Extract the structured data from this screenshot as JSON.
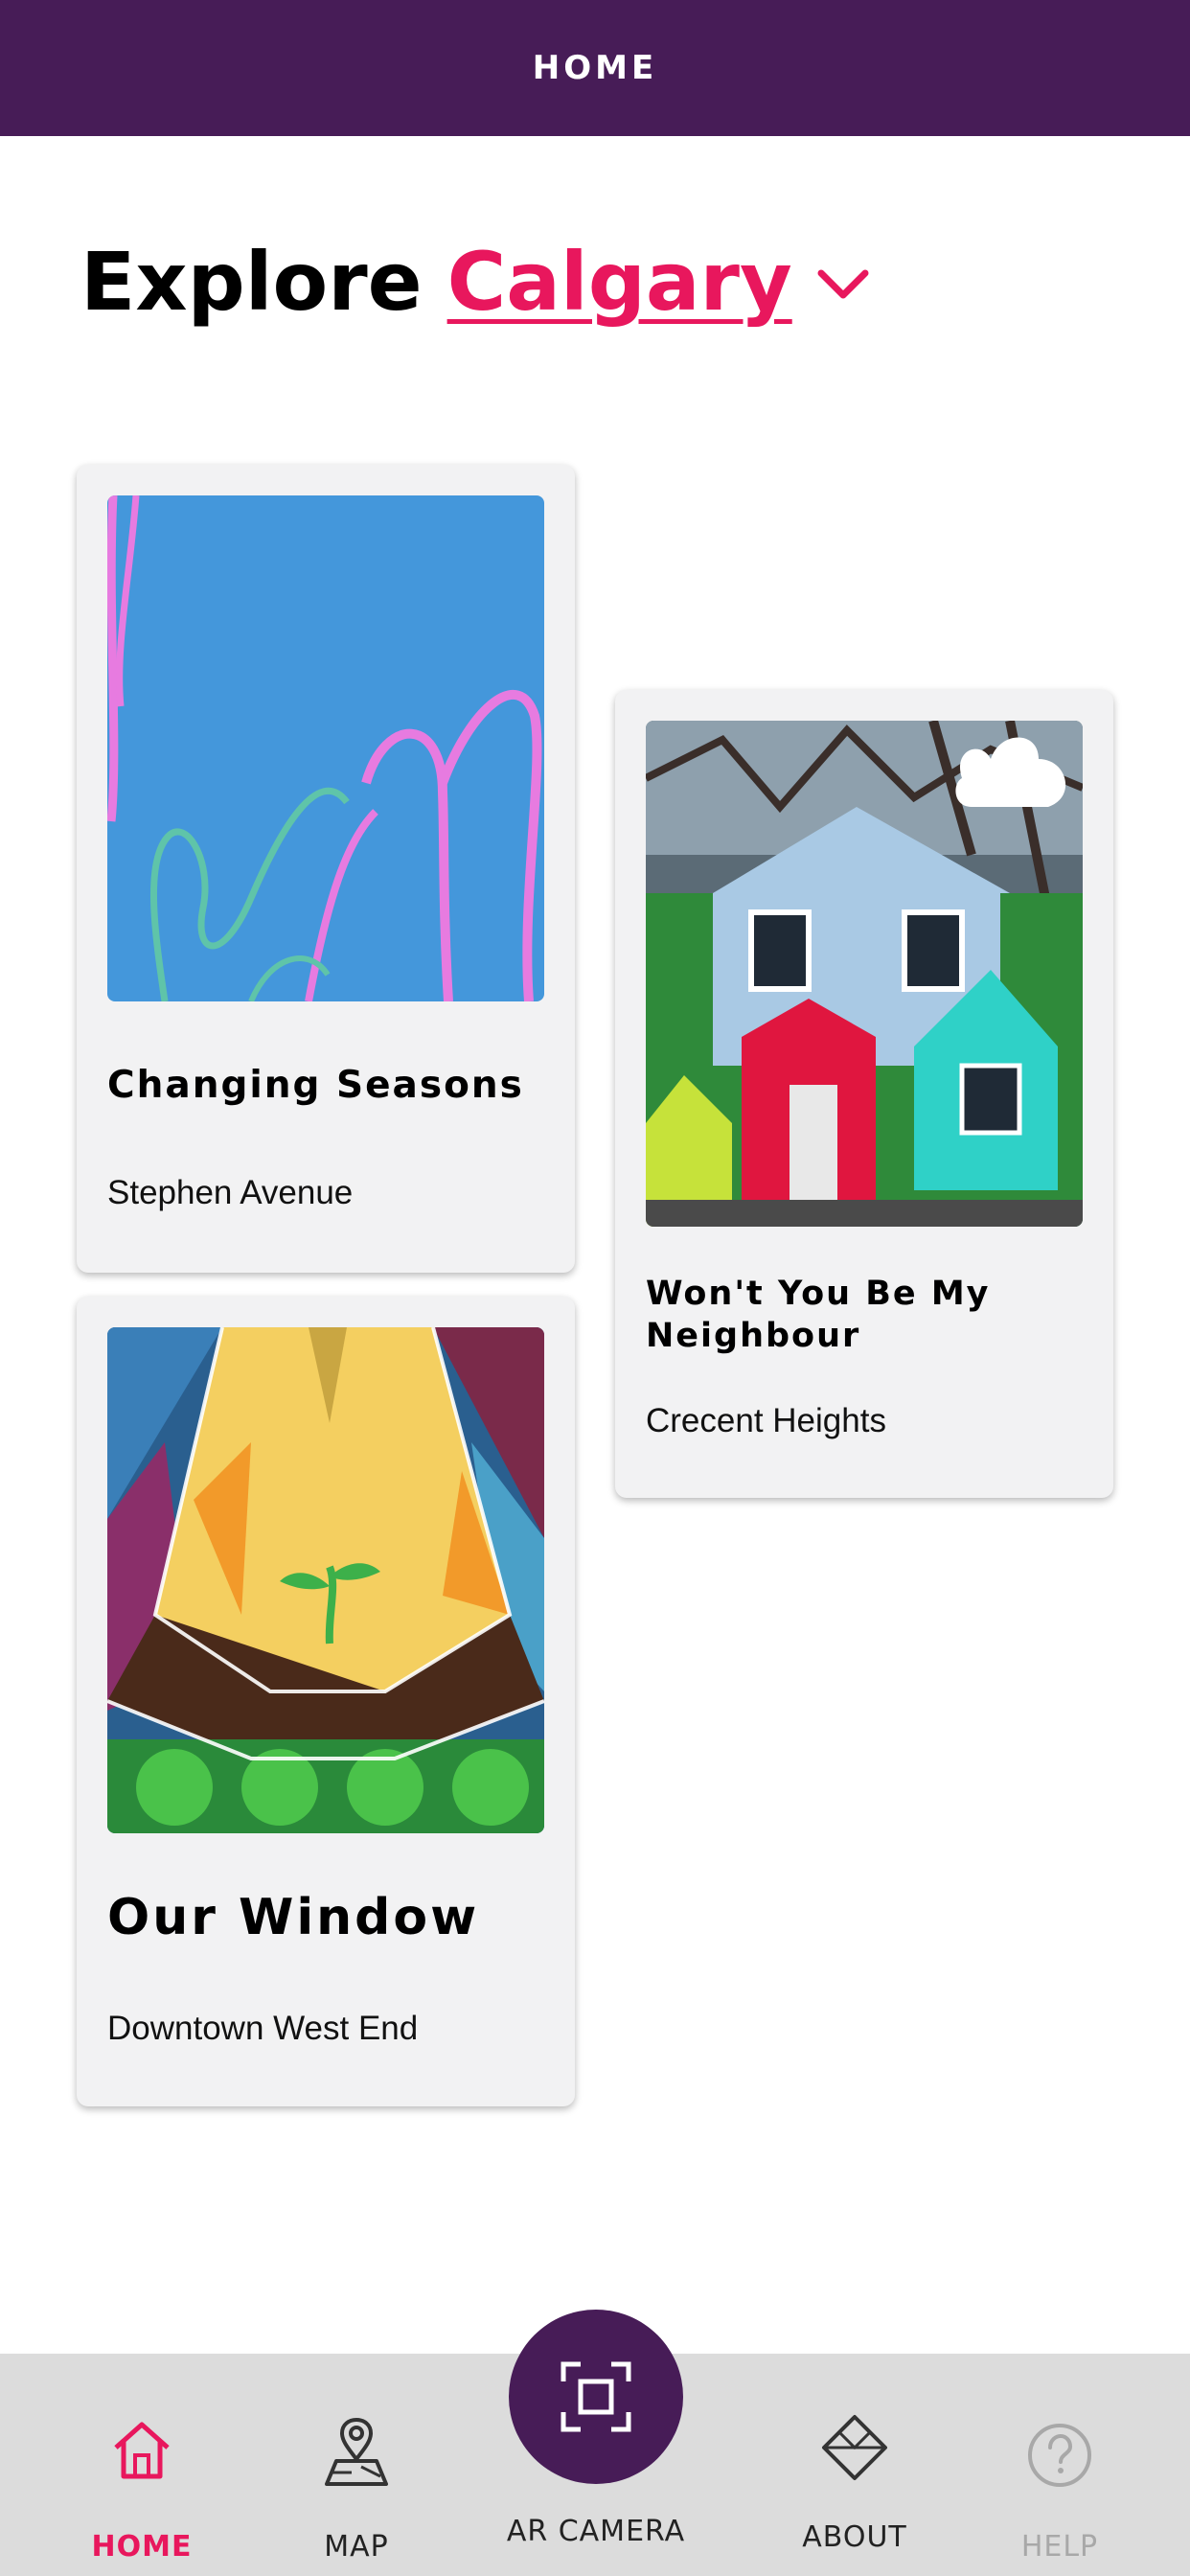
{
  "header": {
    "title": "HOME"
  },
  "explore": {
    "prefix": "Explore",
    "city": "Calgary"
  },
  "cards": [
    {
      "title": "Changing Seasons",
      "location": "Stephen Avenue"
    },
    {
      "title_line1": "Won't You Be My",
      "title_line2": "Neighbour",
      "location": "Crecent Heights"
    },
    {
      "title": "Our Window",
      "location": "Downtown West End"
    }
  ],
  "nav": {
    "items": [
      {
        "label": "HOME",
        "icon": "home-icon",
        "active": true
      },
      {
        "label": "MAP",
        "icon": "map-pin-icon"
      },
      {
        "label": "AR CAMERA",
        "icon": "ar-camera-icon"
      },
      {
        "label": "ABOUT",
        "icon": "diamond-icon"
      },
      {
        "label": "HELP",
        "icon": "help-icon",
        "disabled": true
      }
    ]
  },
  "colors": {
    "header": "#471c57",
    "accent": "#e8175d",
    "card": "#f2f2f3",
    "nav": "#dcdcdc"
  }
}
